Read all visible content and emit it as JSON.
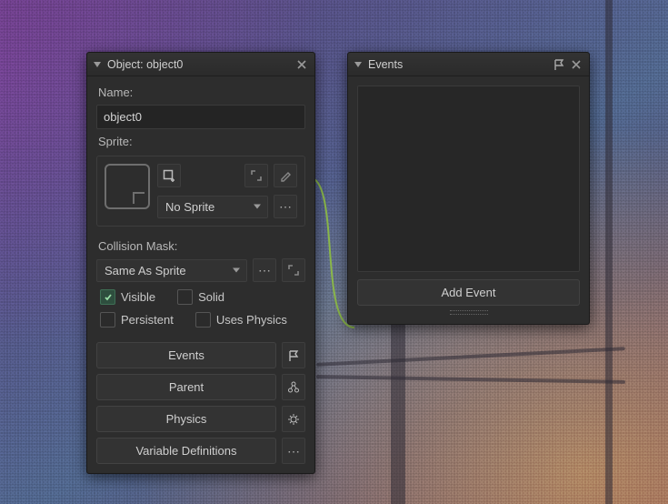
{
  "object_panel": {
    "title": "Object: object0",
    "name_label": "Name:",
    "name_value": "object0",
    "sprite_label": "Sprite:",
    "sprite_dropdown": "No Sprite",
    "collision_label": "Collision Mask:",
    "collision_dropdown": "Same As Sprite",
    "checkboxes": {
      "visible": "Visible",
      "solid": "Solid",
      "persistent": "Persistent",
      "uses_physics": "Uses Physics"
    },
    "buttons": {
      "events": "Events",
      "parent": "Parent",
      "physics": "Physics",
      "vardefs": "Variable Definitions"
    }
  },
  "events_panel": {
    "title": "Events",
    "add_event": "Add Event"
  }
}
